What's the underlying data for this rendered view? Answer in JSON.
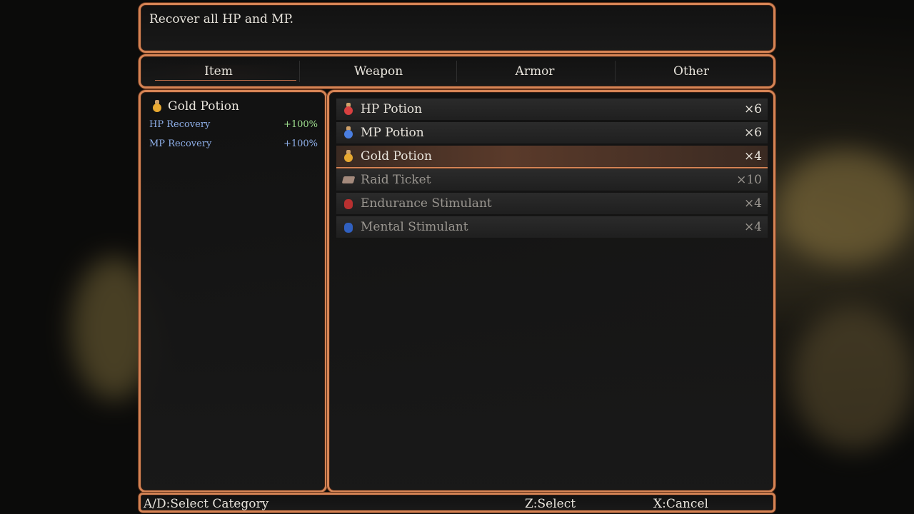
{
  "help": {
    "text": "Recover all HP and MP."
  },
  "tabs": [
    {
      "label": "Item",
      "active": true
    },
    {
      "label": "Weapon",
      "active": false
    },
    {
      "label": "Armor",
      "active": false
    },
    {
      "label": "Other",
      "active": false
    }
  ],
  "detail": {
    "name": "Gold Potion",
    "icon": "gold-potion-icon",
    "stats": [
      {
        "label": "HP Recovery",
        "value": "+100%"
      },
      {
        "label": "MP Recovery",
        "value": "+100%"
      }
    ]
  },
  "items": [
    {
      "name": "HP Potion",
      "qty": "×6",
      "icon": "hp-potion-icon",
      "color": "#d84040"
    },
    {
      "name": "MP Potion",
      "qty": "×6",
      "icon": "mp-potion-icon",
      "color": "#4a7ee0"
    },
    {
      "name": "Gold Potion",
      "qty": "×4",
      "icon": "gold-potion-icon",
      "color": "#e8a830",
      "selected": true
    },
    {
      "name": "Raid Ticket",
      "qty": "×10",
      "icon": "raid-ticket-icon",
      "color": "#a48a7c"
    },
    {
      "name": "Endurance Stimulant",
      "qty": "×4",
      "icon": "endurance-stimulant-icon",
      "color": "#b83030"
    },
    {
      "name": "Mental Stimulant",
      "qty": "×4",
      "icon": "mental-stimulant-icon",
      "color": "#3060c0"
    }
  ],
  "footer": {
    "category": "A/D:Select Category",
    "select": "Z:Select",
    "cancel": "X:Cancel"
  },
  "colors": {
    "border": "#d68455",
    "stat_label": "#8fb0ea",
    "stat_value_positive": "#9fe08f"
  }
}
